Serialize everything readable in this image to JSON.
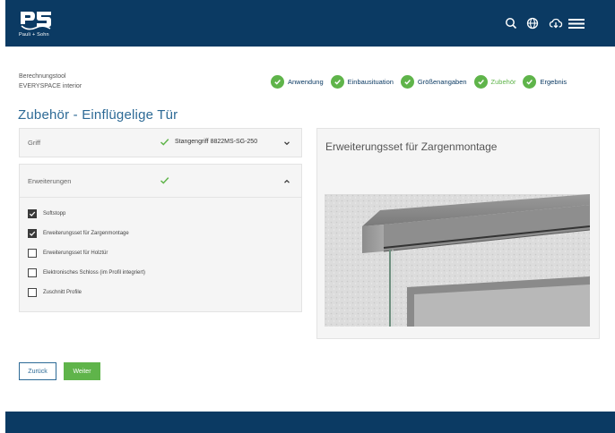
{
  "header": {
    "logo_text": "Pauli + Sohn",
    "icons": [
      "search-icon",
      "globe-icon",
      "cloud-download-icon",
      "hamburger-menu-icon"
    ],
    "bg_color": "#0b3a63"
  },
  "breadcrumb": {
    "tool": "Berechnungstool",
    "product": "EVERYSPACE interior"
  },
  "steps": [
    {
      "label": "Anwendung",
      "active": false
    },
    {
      "label": "Einbausituation",
      "active": false
    },
    {
      "label": "Größenangaben",
      "active": false
    },
    {
      "label": "Zubehör",
      "active": true
    },
    {
      "label": "Ergebnis",
      "active": false
    }
  ],
  "page_title": "Zubehör - Einflügelige Tür",
  "griff": {
    "label": "Griff",
    "value": "Stangengriff 8822MS-SG-250"
  },
  "erweiterungen": {
    "label": "Erweiterungen",
    "options": [
      {
        "label": "Softstopp",
        "checked": true
      },
      {
        "label": "Erweiterungsset für Zargenmontage",
        "checked": true
      },
      {
        "label": "Erweiterungsset für Holztür",
        "checked": false
      },
      {
        "label": "Elektronisches Schloss (im Profil integriert)",
        "checked": false
      },
      {
        "label": "Zuschnitt Profile",
        "checked": false
      }
    ]
  },
  "preview": {
    "title": "Erweiterungsset für Zargenmontage"
  },
  "buttons": {
    "back": "Zurück",
    "next": "Weiter"
  },
  "colors": {
    "accent_green": "#5fb44a",
    "accent_blue": "#2d6a96",
    "navy": "#0b3a63"
  }
}
